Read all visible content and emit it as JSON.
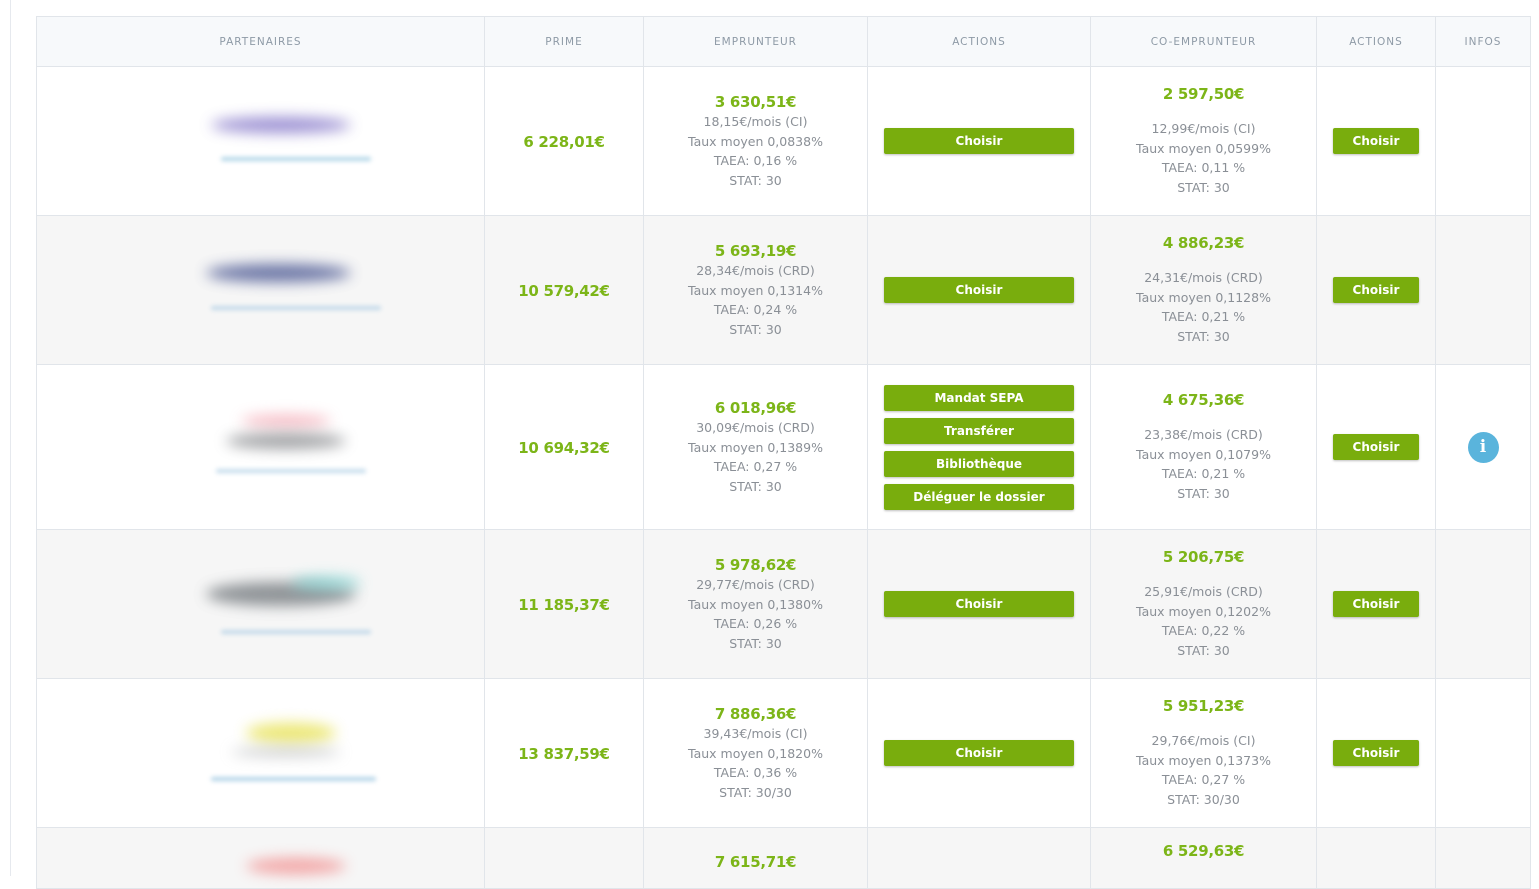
{
  "headers": {
    "partenaires": "PARTENAIRES",
    "prime": "PRIME",
    "emprunteur": "EMPRUNTEUR",
    "actions1": "ACTIONS",
    "co_emprunteur": "CO-EMPRUNTEUR",
    "actions2": "ACTIONS",
    "infos": "INFOS"
  },
  "buttons": {
    "choisir": "Choisir",
    "mandat": "Mandat SEPA",
    "transferer": "Transférer",
    "bibliotheque": "Bibliothèque",
    "deleguer": "Déléguer le dossier"
  },
  "info_icon_glyph": "i",
  "colors": {
    "accent_green": "#79ad0d",
    "amount_green": "#7cb518",
    "info_blue": "#5ab4dc"
  },
  "rows": [
    {
      "prime": "6 228,01€",
      "emp": {
        "amount": "3 630,51€",
        "monthly": "18,15€/mois (CI)",
        "taux": "Taux moyen 0,0838%",
        "taea": "TAEA: 0,16 %",
        "stat": "STAT: 30"
      },
      "co": {
        "amount": "2 597,50€",
        "monthly": "12,99€/mois (CI)",
        "taux": "Taux moyen 0,0599%",
        "taea": "TAEA: 0,11 %",
        "stat": "STAT: 30"
      }
    },
    {
      "prime": "10 579,42€",
      "emp": {
        "amount": "5 693,19€",
        "monthly": "28,34€/mois (CRD)",
        "taux": "Taux moyen 0,1314%",
        "taea": "TAEA: 0,24 %",
        "stat": "STAT: 30"
      },
      "co": {
        "amount": "4 886,23€",
        "monthly": "24,31€/mois (CRD)",
        "taux": "Taux moyen 0,1128%",
        "taea": "TAEA: 0,21 %",
        "stat": "STAT: 30"
      }
    },
    {
      "prime": "10 694,32€",
      "emp": {
        "amount": "6 018,96€",
        "monthly": "30,09€/mois (CRD)",
        "taux": "Taux moyen 0,1389%",
        "taea": "TAEA: 0,27 %",
        "stat": "STAT: 30"
      },
      "co": {
        "amount": "4 675,36€",
        "monthly": "23,38€/mois (CRD)",
        "taux": "Taux moyen 0,1079%",
        "taea": "TAEA: 0,21 %",
        "stat": "STAT: 30"
      }
    },
    {
      "prime": "11 185,37€",
      "emp": {
        "amount": "5 978,62€",
        "monthly": "29,77€/mois (CRD)",
        "taux": "Taux moyen 0,1380%",
        "taea": "TAEA: 0,26 %",
        "stat": "STAT: 30"
      },
      "co": {
        "amount": "5 206,75€",
        "monthly": "25,91€/mois (CRD)",
        "taux": "Taux moyen 0,1202%",
        "taea": "TAEA: 0,22 %",
        "stat": "STAT: 30"
      }
    },
    {
      "prime": "13 837,59€",
      "emp": {
        "amount": "7 886,36€",
        "monthly": "39,43€/mois (CI)",
        "taux": "Taux moyen 0,1820%",
        "taea": "TAEA: 0,36 %",
        "stat": "STAT: 30/30"
      },
      "co": {
        "amount": "5 951,23€",
        "monthly": "29,76€/mois (CI)",
        "taux": "Taux moyen 0,1373%",
        "taea": "TAEA: 0,27 %",
        "stat": "STAT: 30/30"
      }
    },
    {
      "emp": {
        "amount": "7 615,71€"
      },
      "co": {
        "amount": "6 529,63€"
      }
    }
  ]
}
